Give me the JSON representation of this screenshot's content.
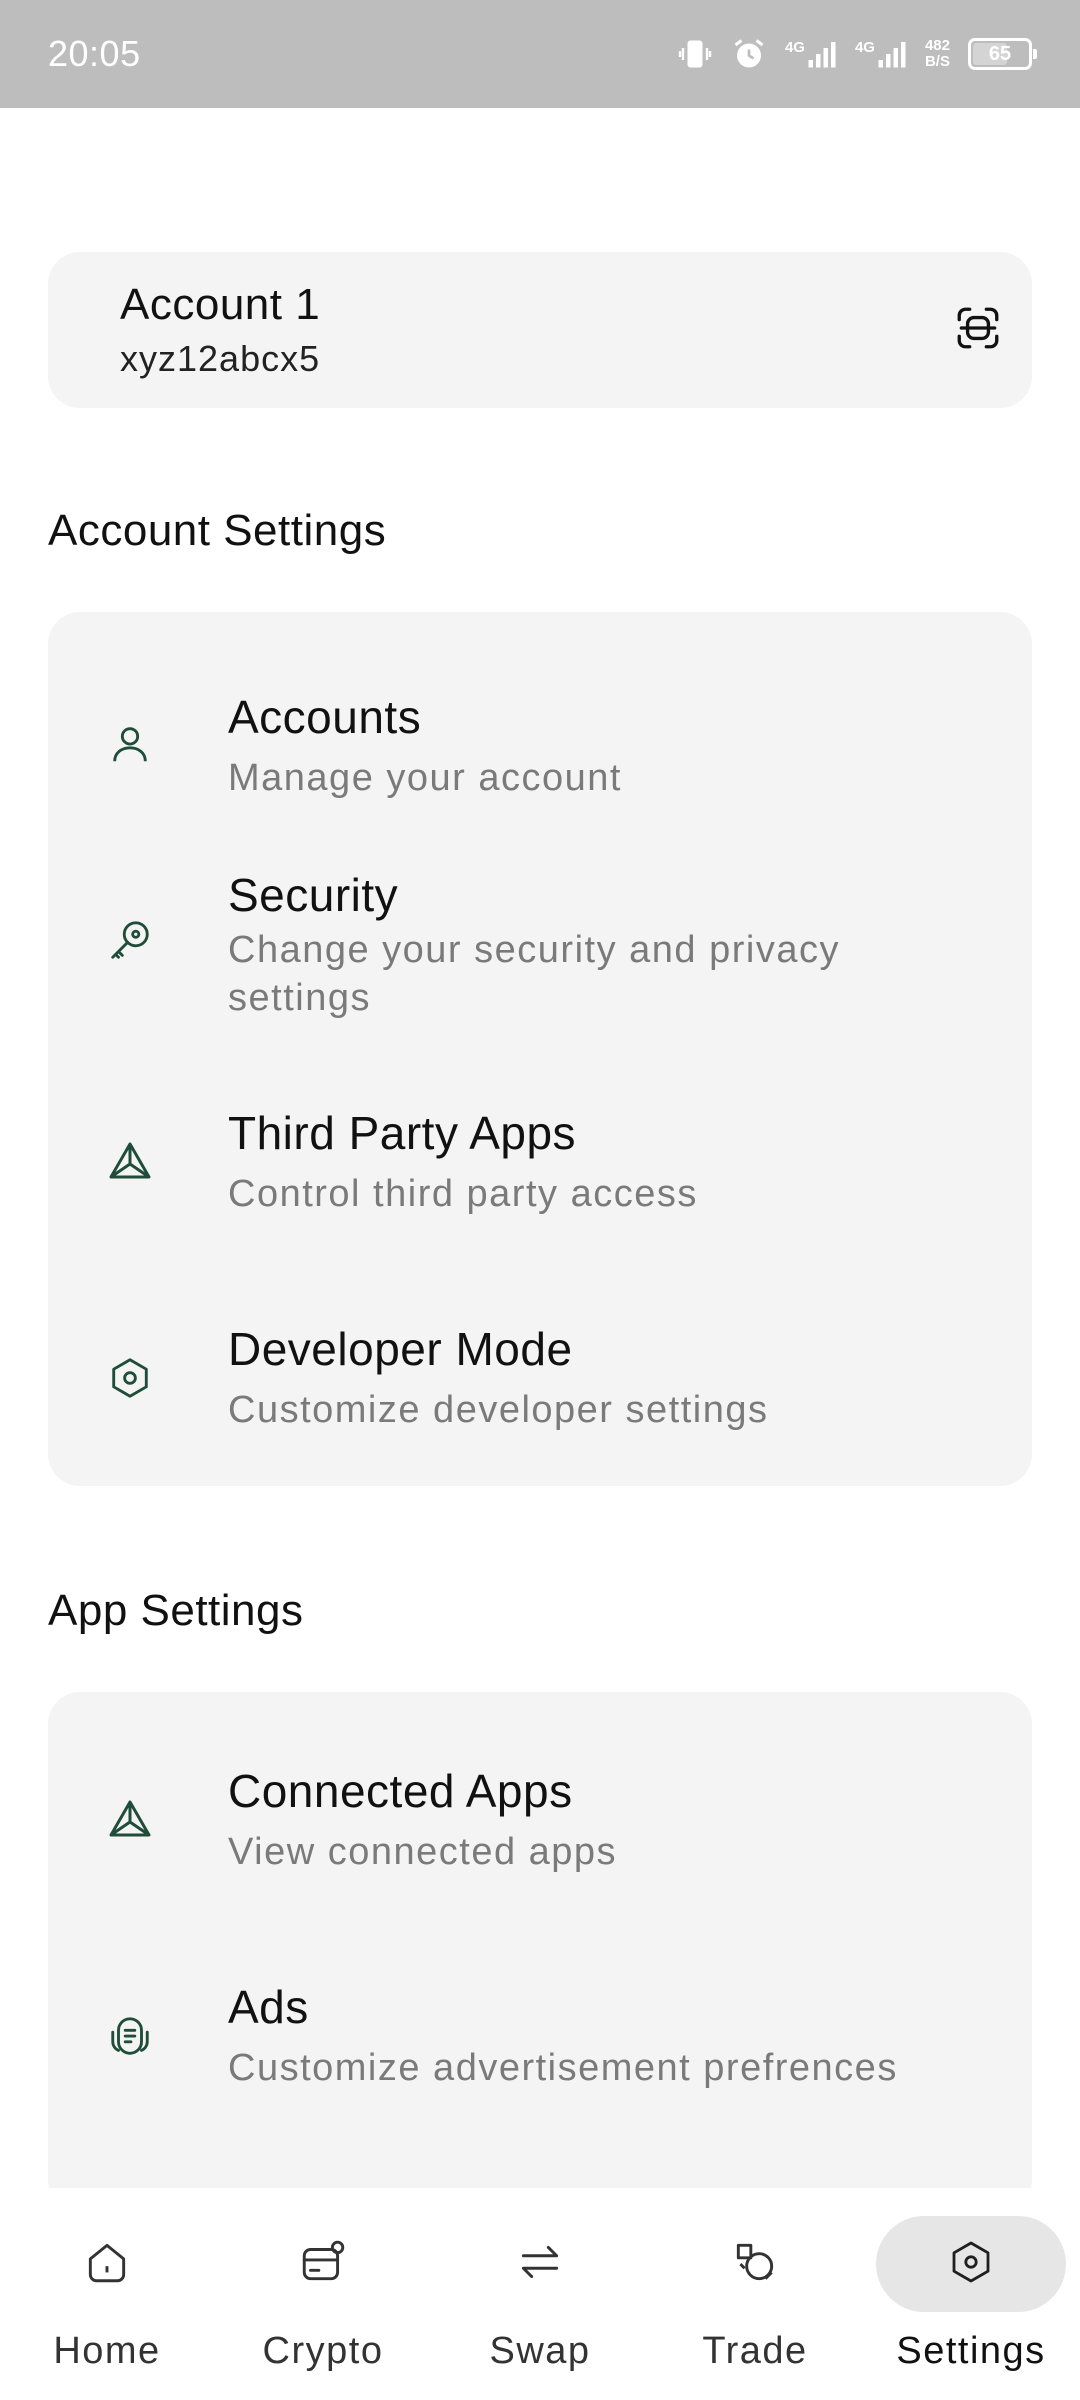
{
  "status_bar": {
    "time": "20:05",
    "network_1": "4G",
    "network_2": "4G",
    "speed_value": "482",
    "speed_unit": "B/S",
    "battery": "65",
    "battery_level": 0.65
  },
  "account": {
    "name": "Account 1",
    "id": "xyz12abcx5"
  },
  "account_settings": {
    "title": "Account Settings",
    "items": [
      {
        "title": "Accounts",
        "subtitle": "Manage your account"
      },
      {
        "title": "Security",
        "subtitle": "Change your security and privacy settings"
      },
      {
        "title": "Third Party Apps",
        "subtitle": "Control third party access"
      },
      {
        "title": "Developer Mode",
        "subtitle": "Customize developer settings"
      }
    ]
  },
  "app_settings": {
    "title": "App Settings",
    "items": [
      {
        "title": "Connected Apps",
        "subtitle": "View connected apps"
      },
      {
        "title": "Ads",
        "subtitle": "Customize advertisement prefrences"
      }
    ]
  },
  "nav": {
    "items": [
      {
        "label": "Home"
      },
      {
        "label": "Crypto"
      },
      {
        "label": "Swap"
      },
      {
        "label": "Trade"
      },
      {
        "label": "Settings"
      }
    ],
    "active": "Settings"
  },
  "colors": {
    "accent_icon": "#1f4d3a",
    "card_bg": "#f4f4f4",
    "status_bar_bg": "#bdbdbd"
  }
}
